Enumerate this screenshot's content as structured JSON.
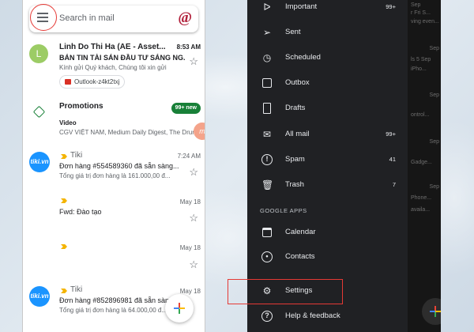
{
  "left_screen": {
    "search": {
      "placeholder": "Search in mail",
      "logo": "@"
    },
    "emails": [
      {
        "avatar": "L",
        "sender": "Linh Do Thi Ha  (AE - Asset...",
        "time": "8:53 AM",
        "subject": "BẢN TIN TÀI SẢN ĐẦU TƯ SÁNG NG...",
        "snippet": "Kính gửi Quý khách, Chúng tôi xin gửi",
        "attachment": "Outlook-z4kt2txj"
      },
      {
        "category": "Promotions",
        "badge": "99+ new",
        "subject": "Video",
        "snippet": "CGV VIỆT NAM, Medium Daily Digest, The Drum"
      },
      {
        "avatar": "tiki.vn",
        "sender": "Tiki",
        "time": "7:24 AM",
        "subject": "Đơn hàng #554589360 đã sẵn sàng...",
        "snippet": "Tổng giá trị đơn hàng là 161.000,00 đ..."
      },
      {
        "sender": "",
        "time": "May 18",
        "subject": "Fwd: Đào tạo",
        "snippet": ""
      },
      {
        "sender": "",
        "time": "May 18",
        "subject": "",
        "snippet": ""
      },
      {
        "avatar": "tiki.vn",
        "sender": "Tiki",
        "time": "May 18",
        "subject": "Đơn hàng #852896981 đã sẵn sàng...",
        "snippet": "Tổng giá trị đơn hàng là 64.000,00 đ..."
      }
    ],
    "side_bubble": "m"
  },
  "right_screen": {
    "menu": [
      {
        "label": "Important",
        "count": "99+",
        "icon": "important-icon"
      },
      {
        "label": "Sent",
        "count": "",
        "icon": "send-icon"
      },
      {
        "label": "Scheduled",
        "count": "",
        "icon": "schedule-icon"
      },
      {
        "label": "Outbox",
        "count": "",
        "icon": "outbox-icon"
      },
      {
        "label": "Drafts",
        "count": "",
        "icon": "draft-icon"
      },
      {
        "label": "All mail",
        "count": "99+",
        "icon": "all-mail-icon"
      },
      {
        "label": "Spam",
        "count": "41",
        "icon": "spam-icon"
      },
      {
        "label": "Trash",
        "count": "7",
        "icon": "trash-icon"
      }
    ],
    "section_google_apps": "GOOGLE APPS",
    "apps": [
      {
        "label": "Calendar",
        "icon": "calendar-icon"
      },
      {
        "label": "Contacts",
        "icon": "contacts-icon"
      }
    ],
    "settings": {
      "label": "Settings",
      "icon": "gear-icon"
    },
    "help": {
      "label": "Help & feedback",
      "icon": "help-icon"
    },
    "behind": [
      "Sep",
      "r Fri S...",
      "ving even...",
      "Sep",
      "ls 5 Sep",
      "iPho...",
      "Sep",
      "ontrol...",
      "Sep",
      "Gadge...",
      "Sep",
      "Phone...",
      "availa..."
    ]
  },
  "colors": {
    "highlight": "#e53935",
    "promo_badge": "#188038",
    "important": "#f4b400",
    "tiki": "#1a94ff"
  }
}
